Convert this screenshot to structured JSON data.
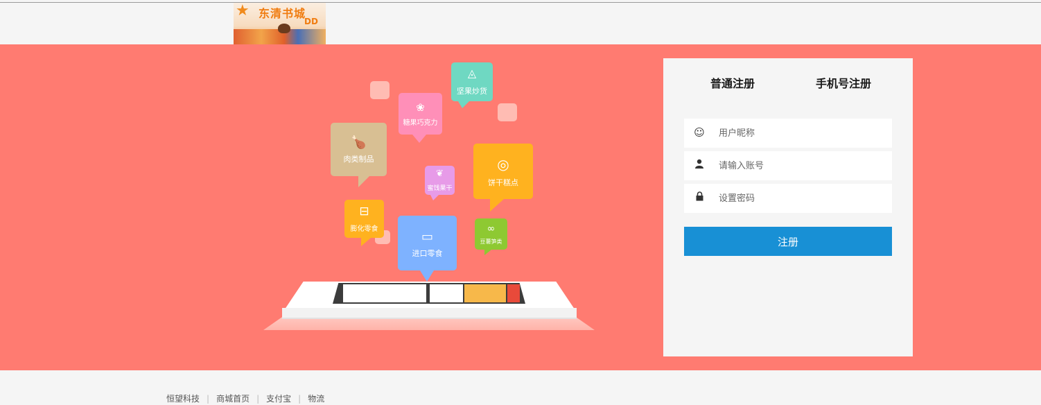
{
  "logo": {
    "title": "东清书城",
    "subtitle": "DD",
    "icon": "star-logo-icon"
  },
  "categories": [
    {
      "label": "坚果炒货",
      "icon": "nut-icon",
      "color": "#6fd8c2"
    },
    {
      "label": "糖果巧克力",
      "icon": "candy-icon",
      "color": "#ff8fb8"
    },
    {
      "label": "肉类制品",
      "icon": "drumstick-icon",
      "color": "#d8bf93"
    },
    {
      "label": "蜜饯果干",
      "icon": "dried-fruit-icon",
      "color": "#e79be8"
    },
    {
      "label": "饼干糕点",
      "icon": "cookie-icon",
      "color": "#ffb21f"
    },
    {
      "label": "膨化零食",
      "icon": "snack-bag-icon",
      "color": "#ffb21f"
    },
    {
      "label": "进口零食",
      "icon": "flag-icon",
      "color": "#7eb2ff"
    },
    {
      "label": "豆薯笋类",
      "icon": "beans-icon",
      "color": "#8ec932"
    }
  ],
  "register": {
    "tabs": [
      "普通注册",
      "手机号注册"
    ],
    "fields": [
      {
        "placeholder": "用户昵称",
        "icon": "smiley-icon"
      },
      {
        "placeholder": "请输入账号",
        "icon": "user-icon"
      },
      {
        "placeholder": "设置密码",
        "icon": "lock-icon"
      }
    ],
    "submit_label": "注册",
    "accent": "#1890d5"
  },
  "footer": {
    "links": [
      "恒望科技",
      "商城首页",
      "支付宝",
      "物流"
    ]
  },
  "colors": {
    "banner": "#ff7b71",
    "page": "#f5f5f5"
  }
}
